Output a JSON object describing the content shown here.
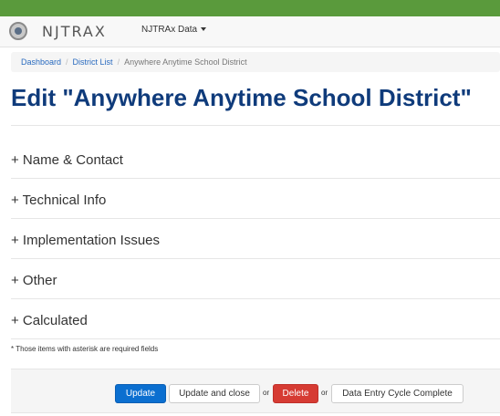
{
  "colors": {
    "topbar": "#5a9a3c",
    "title": "#0f3b7b",
    "primary": "#0b6fd0",
    "danger": "#d63b33",
    "link": "#2a6bbf"
  },
  "navbar": {
    "logo_icon": "state-seal-icon",
    "brand": "NJTRAX",
    "menu_label": "NJTRAx Data",
    "menu_icon": "chevron-down-icon"
  },
  "breadcrumb": {
    "items": [
      "Dashboard",
      "District List"
    ],
    "separator": "/",
    "current": "Anywhere Anytime School District"
  },
  "title": "Edit \"Anywhere Anytime School District\"",
  "sections": [
    {
      "label": "+ Name & Contact"
    },
    {
      "label": "+ Technical Info"
    },
    {
      "label": "+ Implementation Issues"
    },
    {
      "label": "+ Other"
    },
    {
      "label": "+ Calculated"
    }
  ],
  "note": "* Those items with asterisk are required fields",
  "actions": {
    "update": "Update",
    "update_close": "Update and close",
    "or": "or",
    "delete": "Delete",
    "cycle_complete": "Data Entry Cycle Complete"
  }
}
